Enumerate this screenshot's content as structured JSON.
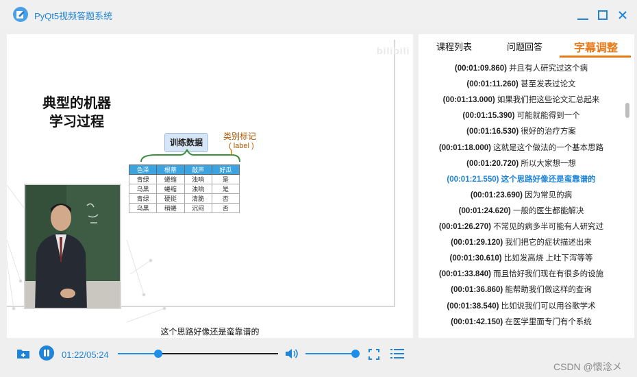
{
  "window": {
    "title": "PyQt5视频答题系统"
  },
  "video": {
    "watermark": "bilibili",
    "slide_heading": "典型的机器\n学习过程",
    "training_data_label": "训练数据",
    "label_title": "类别标记",
    "label_sub": "( label )",
    "table": {
      "headers": [
        "色泽",
        "根蒂",
        "敲声",
        "好瓜"
      ],
      "rows": [
        [
          "青绿",
          "蜷缩",
          "浊响",
          "是"
        ],
        [
          "乌黑",
          "蜷缩",
          "浊响",
          "是"
        ],
        [
          "青绿",
          "硬挺",
          "清脆",
          "否"
        ],
        [
          "乌黑",
          "稍蜷",
          "沉闷",
          "否"
        ]
      ]
    },
    "subtitle": "这个思路好像还是蛮靠谱的"
  },
  "player": {
    "time": "01:22/05:24",
    "progress": 0.2531,
    "volume": 0.99,
    "icons": {
      "open": "folder-icon",
      "pause": "pause-icon",
      "volume": "volume-icon",
      "fullscreen": "fullscreen-icon",
      "playlist": "list-icon"
    }
  },
  "side_panel": {
    "tabs": [
      "课程列表",
      "问题回答",
      "字幕调整"
    ],
    "active_tab": 2,
    "subtitles": [
      {
        "ts": "(00:01:09.860)",
        "text": "并且有人研究过这个病"
      },
      {
        "ts": "(00:01:11.260)",
        "text": "甚至发表过论文"
      },
      {
        "ts": "(00:01:13.000)",
        "text": "如果我们把这些论文汇总起来"
      },
      {
        "ts": "(00:01:15.390)",
        "text": "可能就能得到一个"
      },
      {
        "ts": "(00:01:16.530)",
        "text": "很好的治疗方案"
      },
      {
        "ts": "(00:01:18.000)",
        "text": "这就是这个做法的一个基本思路"
      },
      {
        "ts": "(00:01:20.720)",
        "text": "所以大家想一想"
      },
      {
        "ts": "(00:01:21.550)",
        "text": "这个思路好像还是蛮靠谱的"
      },
      {
        "ts": "(00:01:23.690)",
        "text": "因为常见的病"
      },
      {
        "ts": "(00:01:24.620)",
        "text": "一般的医生都能解决"
      },
      {
        "ts": "(00:01:26.270)",
        "text": "不常见的病多半可能有人研究过"
      },
      {
        "ts": "(00:01:29.120)",
        "text": "我们把它的症状描述出来"
      },
      {
        "ts": "(00:01:30.610)",
        "text": "比如发高烧 上吐下泻等等"
      },
      {
        "ts": "(00:01:33.840)",
        "text": "而且恰好我们现在有很多的设施"
      },
      {
        "ts": "(00:01:36.860)",
        "text": "能帮助我们做这样的查询"
      },
      {
        "ts": "(00:01:38.540)",
        "text": "比如说我们可以用谷歌学术"
      },
      {
        "ts": "(00:01:42.150)",
        "text": "在医学里面专门有个系统"
      }
    ],
    "current_index": 7
  },
  "footer_watermark": "CSDN @懷淰メ",
  "colors": {
    "accent_blue": "#1f84d8",
    "accent_orange": "#e87a1a"
  }
}
